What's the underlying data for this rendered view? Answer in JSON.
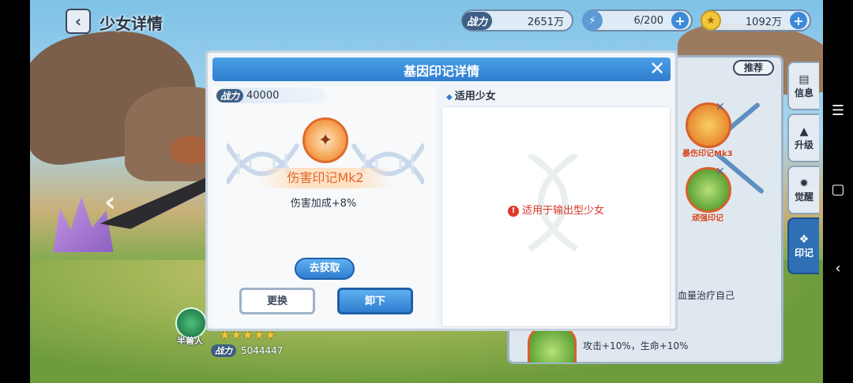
{
  "header": {
    "back_icon": "chevron-left-icon",
    "title": "少女详情",
    "power_label": "战力",
    "power_value": "2651万",
    "stamina_value": "6/200",
    "gold_value": "1092万"
  },
  "background_panel": {
    "recommend_label": "推荐",
    "node1_label": "暴伤印记Mk3",
    "node2_label": "顽强印记",
    "text_line1": "血量治疗自己",
    "text_line2": "攻击+10%，生命+10%"
  },
  "side_tabs": [
    {
      "label": "信息",
      "icon": "info-icon",
      "active": false
    },
    {
      "label": "升级",
      "icon": "upgrade-icon",
      "active": false
    },
    {
      "label": "觉醒",
      "icon": "awaken-icon",
      "active": false
    },
    {
      "label": "印记",
      "icon": "mark-icon",
      "active": true
    }
  ],
  "character": {
    "type": "半兽人",
    "stars": "★★★★★",
    "power_label": "战力",
    "power_value": "5044447"
  },
  "modal": {
    "title": "基因印记详情",
    "close_icon": "close-icon",
    "power_label": "战力",
    "power_value": "40000",
    "gene_name": "伤害印记Mk2",
    "gene_effect": "伤害加成+8%",
    "obtain_label": "去获取",
    "replace_label": "更换",
    "unload_label": "卸下",
    "applicable_title": "适用少女",
    "applicable_message": "适用于输出型少女"
  },
  "colors": {
    "accent": "#2f7dd0",
    "warning": "#d9362b",
    "gene_name": "#e2672a"
  }
}
